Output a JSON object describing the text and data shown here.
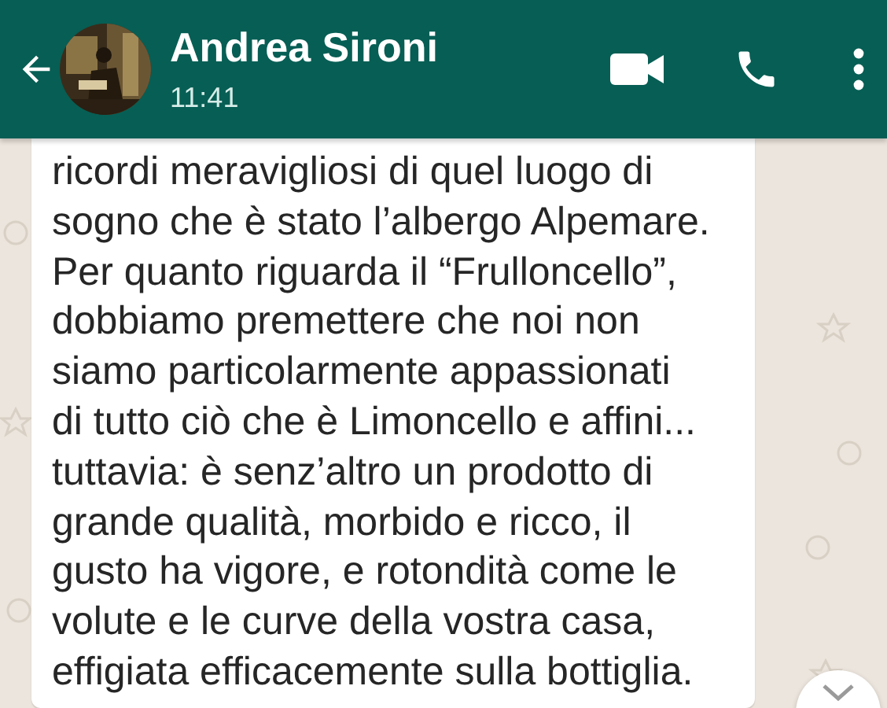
{
  "header": {
    "contact_name": "Andrea Sironi",
    "last_seen": "11:41"
  },
  "message": {
    "lines": [
      "ricordi meravigliosi di quel luogo di",
      "sogno che è stato l’albergo Alpemare.",
      "Per quanto riguarda il “Frulloncello”,",
      "dobbiamo premettere che noi non",
      "siamo particolarmente appassionati",
      "di tutto ciò che è Limoncello e affini...",
      "tuttavia: è senz’altro un prodotto di",
      "grande qualità, morbido e ricco, il",
      "gusto ha vigore, e rotondità come le",
      "volute e le curve della vostra casa,",
      "effigiata efficacemente sulla bottiglia."
    ]
  }
}
